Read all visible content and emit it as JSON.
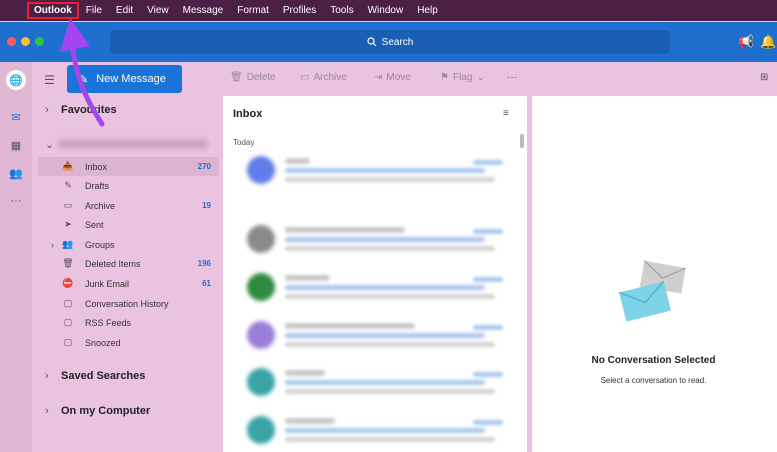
{
  "menubar": {
    "items": [
      {
        "label": "Outlook",
        "highlighted": true
      },
      {
        "label": "File"
      },
      {
        "label": "Edit"
      },
      {
        "label": "View"
      },
      {
        "label": "Message"
      },
      {
        "label": "Format"
      },
      {
        "label": "Profiles"
      },
      {
        "label": "Tools"
      },
      {
        "label": "Window"
      },
      {
        "label": "Help"
      }
    ]
  },
  "titlebar": {
    "search_label": "Search"
  },
  "toolbar": {
    "new_message": "New Message",
    "delete": "Delete",
    "archive": "Archive",
    "move": "Move",
    "flag": "Flag"
  },
  "folders": {
    "favourites": "Favourites",
    "items": [
      {
        "label": "Inbox",
        "count": "270",
        "icon": "inbox-icon",
        "selected": true
      },
      {
        "label": "Drafts",
        "count": "",
        "icon": "drafts-icon"
      },
      {
        "label": "Archive",
        "count": "19",
        "icon": "archive-icon"
      },
      {
        "label": "Sent",
        "count": "",
        "icon": "sent-icon"
      },
      {
        "label": "Groups",
        "count": "",
        "icon": "groups-icon"
      },
      {
        "label": "Deleted Items",
        "count": "196",
        "icon": "trash-icon"
      },
      {
        "label": "Junk Email",
        "count": "61",
        "icon": "junk-icon"
      },
      {
        "label": "Conversation History",
        "count": "",
        "icon": "folder-icon"
      },
      {
        "label": "RSS Feeds",
        "count": "",
        "icon": "folder-icon"
      },
      {
        "label": "Snoozed",
        "count": "",
        "icon": "folder-icon"
      }
    ],
    "saved_searches": "Saved Searches",
    "on_my_computer": "On my Computer"
  },
  "list": {
    "title": "Inbox",
    "group_today": "Today"
  },
  "reading": {
    "title": "No Conversation Selected",
    "subtitle": "Select a conversation to read."
  },
  "colors": {
    "accent": "#1f6fcf",
    "menubar": "#4c1f44",
    "sidebar": "#e9c3df",
    "arrow": "#a246f0",
    "highlight_box": "#e8232f"
  }
}
